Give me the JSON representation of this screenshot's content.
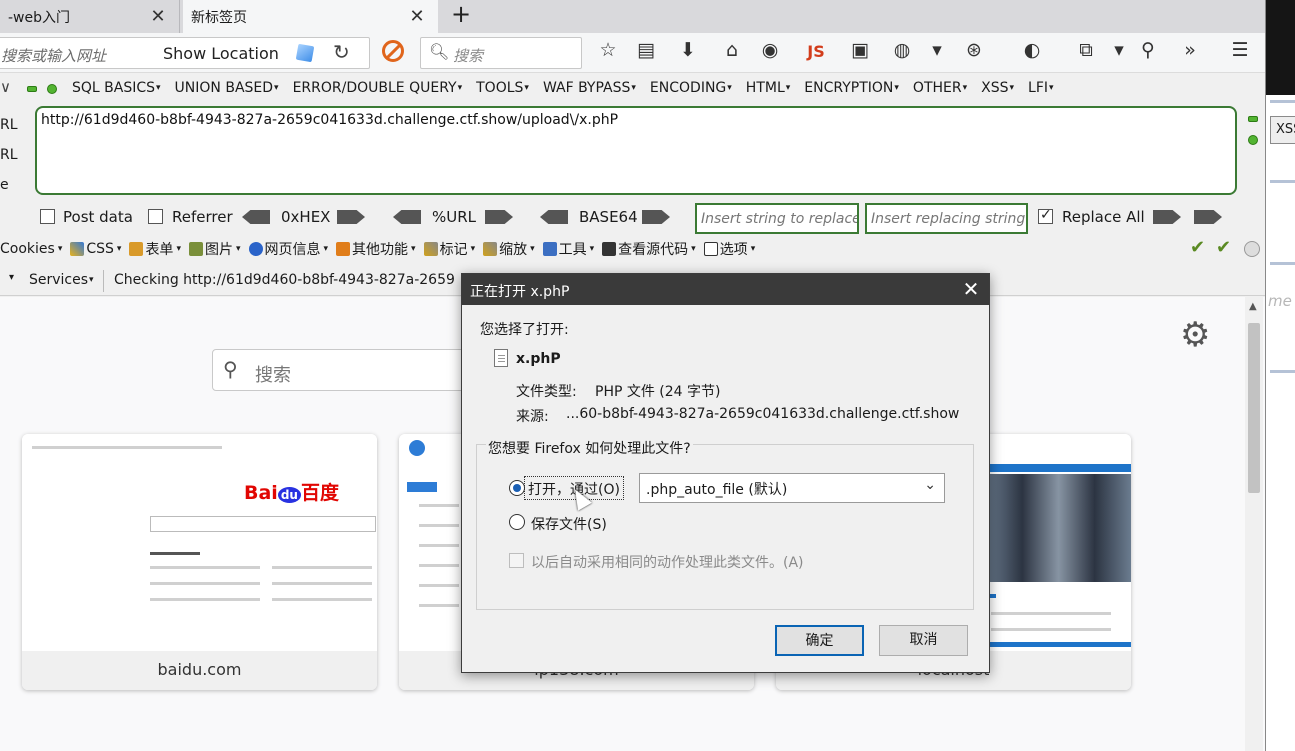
{
  "tabs": [
    {
      "title": "-web入门",
      "close": "✕"
    },
    {
      "title": "新标签页",
      "close": "✕"
    }
  ],
  "new_tab": "+",
  "navbar": {
    "url_placeholder": "搜索或输入网址",
    "show_location": "Show Location",
    "search_placeholder": "搜索",
    "js_label": "JS"
  },
  "hackbar": {
    "menu": [
      "SQL BASICS",
      "UNION BASED",
      "ERROR/DOUBLE QUERY",
      "TOOLS",
      "WAF BYPASS",
      "ENCODING",
      "HTML",
      "ENCRYPTION",
      "OTHER",
      "XSS",
      "LFI"
    ],
    "labels": [
      "RL",
      "RL",
      "e"
    ],
    "url_value": "http://61d9d460-b8bf-4943-827a-2659c041633d.challenge.ctf.show/upload\\/x.phP",
    "post_data": "Post data",
    "referrer": "Referrer",
    "hex": "0xHEX",
    "url_enc": "%URL",
    "base64": "BASE64",
    "insert_replace_ph": "Insert string to replace",
    "insert_replacing_ph": "Insert replacing string",
    "replace_all": "Replace All",
    "replace_all_checked": true
  },
  "webdev_toolbar": {
    "items": [
      "Cookies",
      "CSS",
      "表单",
      "图片",
      "网页信息",
      "其他功能",
      "标记",
      "缩放",
      "工具",
      "查看源代码",
      "选项"
    ]
  },
  "services_bar": {
    "services": "Services",
    "checking": "Checking http://61d9d460-b8bf-4943-827a-2659"
  },
  "newtab": {
    "search_placeholder": "搜索",
    "tiles": [
      {
        "label": "baidu.com"
      },
      {
        "label": "ip138.com"
      },
      {
        "label": "localhost"
      }
    ],
    "baidu_logo": {
      "bai": "Bai",
      "du": "du",
      "cn": "百度"
    }
  },
  "right_panel": {
    "xss_tab": "XSS",
    "italic_text": "me"
  },
  "dialog": {
    "title": "正在打开 x.phP",
    "close": "✕",
    "chosen_label": "您选择了打开:",
    "filename": "x.phP",
    "filetype_label": "文件类型:",
    "filetype_value": "PHP 文件 (24 字节)",
    "source_label": "来源:",
    "source_value": "...60-b8bf-4943-827a-2659c041633d.challenge.ctf.show",
    "question": "您想要 Firefox 如何处理此文件?",
    "open_with": "打开，通过(O)",
    "app_selected": ".php_auto_file (默认)",
    "save_file": "保存文件(S)",
    "auto_action": "以后自动采用相同的动作处理此类文件。(A)",
    "ok": "确定",
    "cancel": "取消",
    "selected_option": "open_with"
  }
}
